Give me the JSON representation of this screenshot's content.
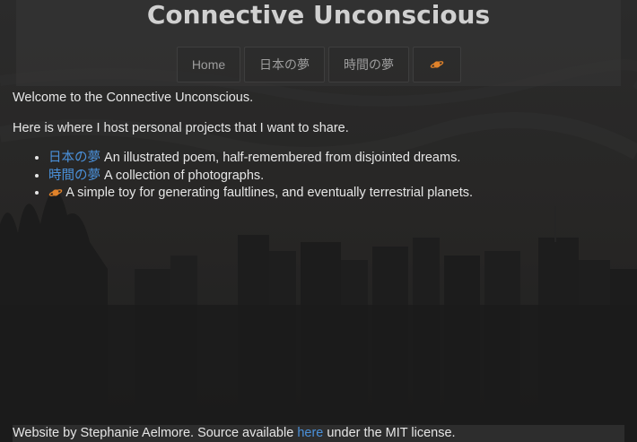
{
  "header": {
    "title": "Connective Unconscious",
    "nav": [
      {
        "label": "Home"
      },
      {
        "label": "日本の夢"
      },
      {
        "label": "時間の夢"
      },
      {
        "icon": "planet-icon"
      }
    ]
  },
  "main": {
    "welcome": "Welcome to the Connective Unconscious.",
    "intro": "Here is where I host personal projects that I want to share.",
    "projects": [
      {
        "link": "日本の夢",
        "description": " An illustrated poem, half-remembered from disjointed dreams."
      },
      {
        "link": "時間の夢",
        "description": " A collection of photographs."
      },
      {
        "icon": "planet-icon",
        "description": " A simple toy for generating faultlines, and eventually terrestrial planets."
      }
    ]
  },
  "footer": {
    "prefix": "Website by Stephanie Aelmore. Source available ",
    "link": "here",
    "suffix": " under the MIT license."
  },
  "colors": {
    "link": "#4a90d9",
    "planet": "#e0822a",
    "text": "#e6e6e6"
  }
}
